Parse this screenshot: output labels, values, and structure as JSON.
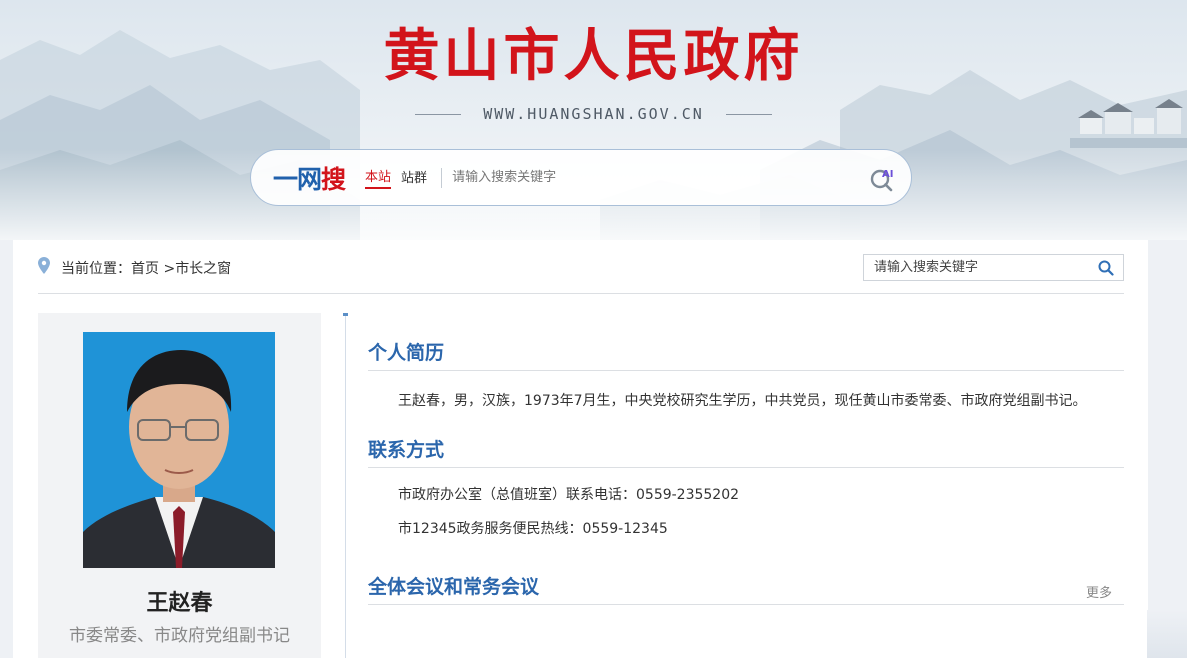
{
  "header": {
    "site_title": "黄山市人民政府",
    "site_url": "WWW.HUANGSHAN.GOV.CN",
    "search": {
      "brand_prefix": "一网",
      "brand_suffix": "搜",
      "scope_options": [
        "本站",
        "站群"
      ],
      "selected_scope": "本站",
      "placeholder": "请输入搜索关键字",
      "ai_label": "AI"
    }
  },
  "breadcrumb": {
    "prefix": "当前位置：",
    "home": "首页",
    "separator": " >",
    "current": "市长之窗"
  },
  "top_search": {
    "placeholder": "请输入搜索关键字"
  },
  "profile": {
    "name": "王赵春",
    "title": "市委常委、市政府党组副书记"
  },
  "sections": {
    "bio": {
      "heading": "个人简历",
      "text": "王赵春，男，汉族，1973年7月生，中央党校研究生学历，中共党员，现任黄山市委常委、市政府党组副书记。"
    },
    "contact": {
      "heading": "联系方式",
      "lines": [
        "市政府办公室（总值班室）联系电话：0559-2355202",
        "市12345政务服务便民热线：0559-12345"
      ]
    },
    "meetings": {
      "heading": "全体会议和常务会议",
      "more_label": "更多"
    }
  },
  "colors": {
    "title_red": "#d2141b",
    "heading_blue": "#2b66ac",
    "brand_blue": "#2061ac",
    "photo_bg": "#1f93d7"
  }
}
